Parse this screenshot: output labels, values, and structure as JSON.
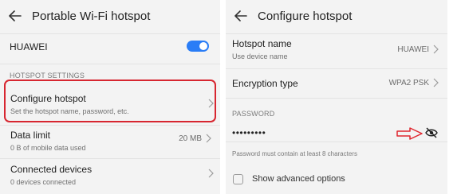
{
  "left": {
    "title": "Portable Wi-Fi hotspot",
    "hotspot_toggle": {
      "label": "HUAWEI",
      "on": true
    },
    "section_header": "HOTSPOT SETTINGS",
    "items": [
      {
        "title": "Configure hotspot",
        "subtitle": "Set the hotspot name, password, etc.",
        "value": ""
      },
      {
        "title": "Data limit",
        "subtitle": "0 B of mobile data used",
        "value": "20 MB"
      },
      {
        "title": "Connected devices",
        "subtitle": "0 devices connected",
        "value": ""
      }
    ]
  },
  "right": {
    "title": "Configure hotspot",
    "hotspot_name": {
      "label": "Hotspot name",
      "sub": "Use device name",
      "value": "HUAWEI"
    },
    "encryption": {
      "label": "Encryption type",
      "value": "WPA2 PSK"
    },
    "password": {
      "label": "PASSWORD",
      "value": "•••••••••",
      "hint": "Password must contain at least 8 characters"
    },
    "advanced": {
      "label": "Show advanced options",
      "checked": false
    }
  },
  "colors": {
    "accent": "#2a7df6",
    "highlight": "#d72630",
    "background": "#f3f3f3"
  },
  "icons": [
    "back-arrow-icon",
    "chevron-right-icon",
    "eye-off-icon",
    "red-arrow-icon"
  ]
}
